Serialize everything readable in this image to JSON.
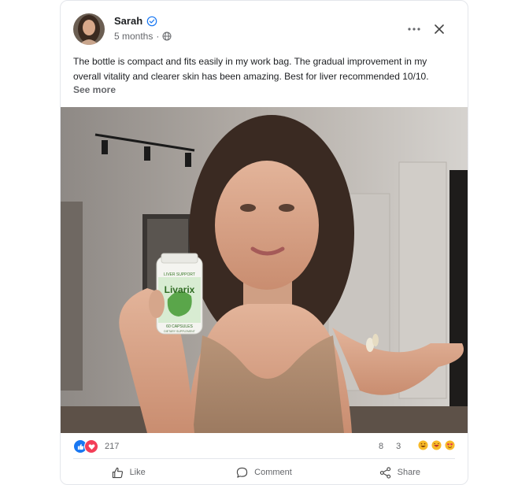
{
  "post": {
    "author": "Sarah",
    "verified_icon": "verified-badge-icon",
    "time": "5 months",
    "separator": "·",
    "privacy_icon": "globe-icon",
    "text": "The bottle is compact and fits easily in my work bag. The gradual improvement in my overall vitality and clearer skin has been amazing. Best for liver recommended 10/10.",
    "see_more": "See more"
  },
  "product": {
    "brand": "Livarix",
    "label_top": "LIVER SUPPORT",
    "label_bottom": "60 CAPSULES",
    "label_sub": "DIETARY SUPPLEMENT"
  },
  "stats": {
    "reactions_count": "217",
    "comments_count": "8",
    "shares_count": "3"
  },
  "actions": {
    "like": "Like",
    "comment": "Comment",
    "share": "Share"
  },
  "colors": {
    "like_blue": "#1877f2",
    "love_red": "#f33e58",
    "verified_blue": "#1877f2",
    "text_gray": "#65676b"
  }
}
